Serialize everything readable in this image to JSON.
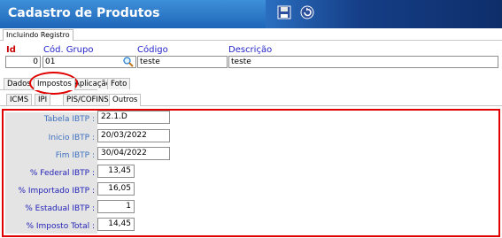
{
  "window": {
    "title": "Cadastro de Produtos"
  },
  "toolbar": {
    "save_icon": "save-icon",
    "back_icon": "back-icon"
  },
  "subtab": {
    "label": "Incluindo Registro"
  },
  "header": {
    "id_label": "Id",
    "id_value": "0",
    "grupo_label": "Cód. Grupo",
    "grupo_value": "01",
    "codigo_label": "Código",
    "codigo_value": "teste",
    "descricao_label": "Descrição",
    "descricao_value": "teste"
  },
  "tabs": [
    {
      "label": "Dados"
    },
    {
      "label": "Impostos"
    },
    {
      "label": "Aplicação"
    },
    {
      "label": "Foto"
    }
  ],
  "subtabs": [
    {
      "label": "ICMS"
    },
    {
      "label": "IPI"
    },
    {
      "label": "PIS/COFINS"
    },
    {
      "label": "Outros"
    }
  ],
  "ibpt": {
    "tabela_label": "Tabela IBTP :",
    "tabela_value": "22.1.D",
    "inicio_label": "Inicio IBTP :",
    "inicio_value": "20/03/2022",
    "fim_label": "Fim IBTP :",
    "fim_value": "30/04/2022",
    "federal_label": "% Federal IBTP :",
    "federal_value": "13,45",
    "importado_label": "% Importado IBTP :",
    "importado_value": "16,05",
    "estadual_label": "% Estadual IBTP :",
    "estadual_value": "1",
    "total_label": "% Imposto Total :",
    "total_value": "14,45"
  },
  "colors": {
    "title_bar": "#1f66b8",
    "highlight": "#e00000",
    "label_blue": "#2323c8",
    "id_red": "#c80000"
  }
}
